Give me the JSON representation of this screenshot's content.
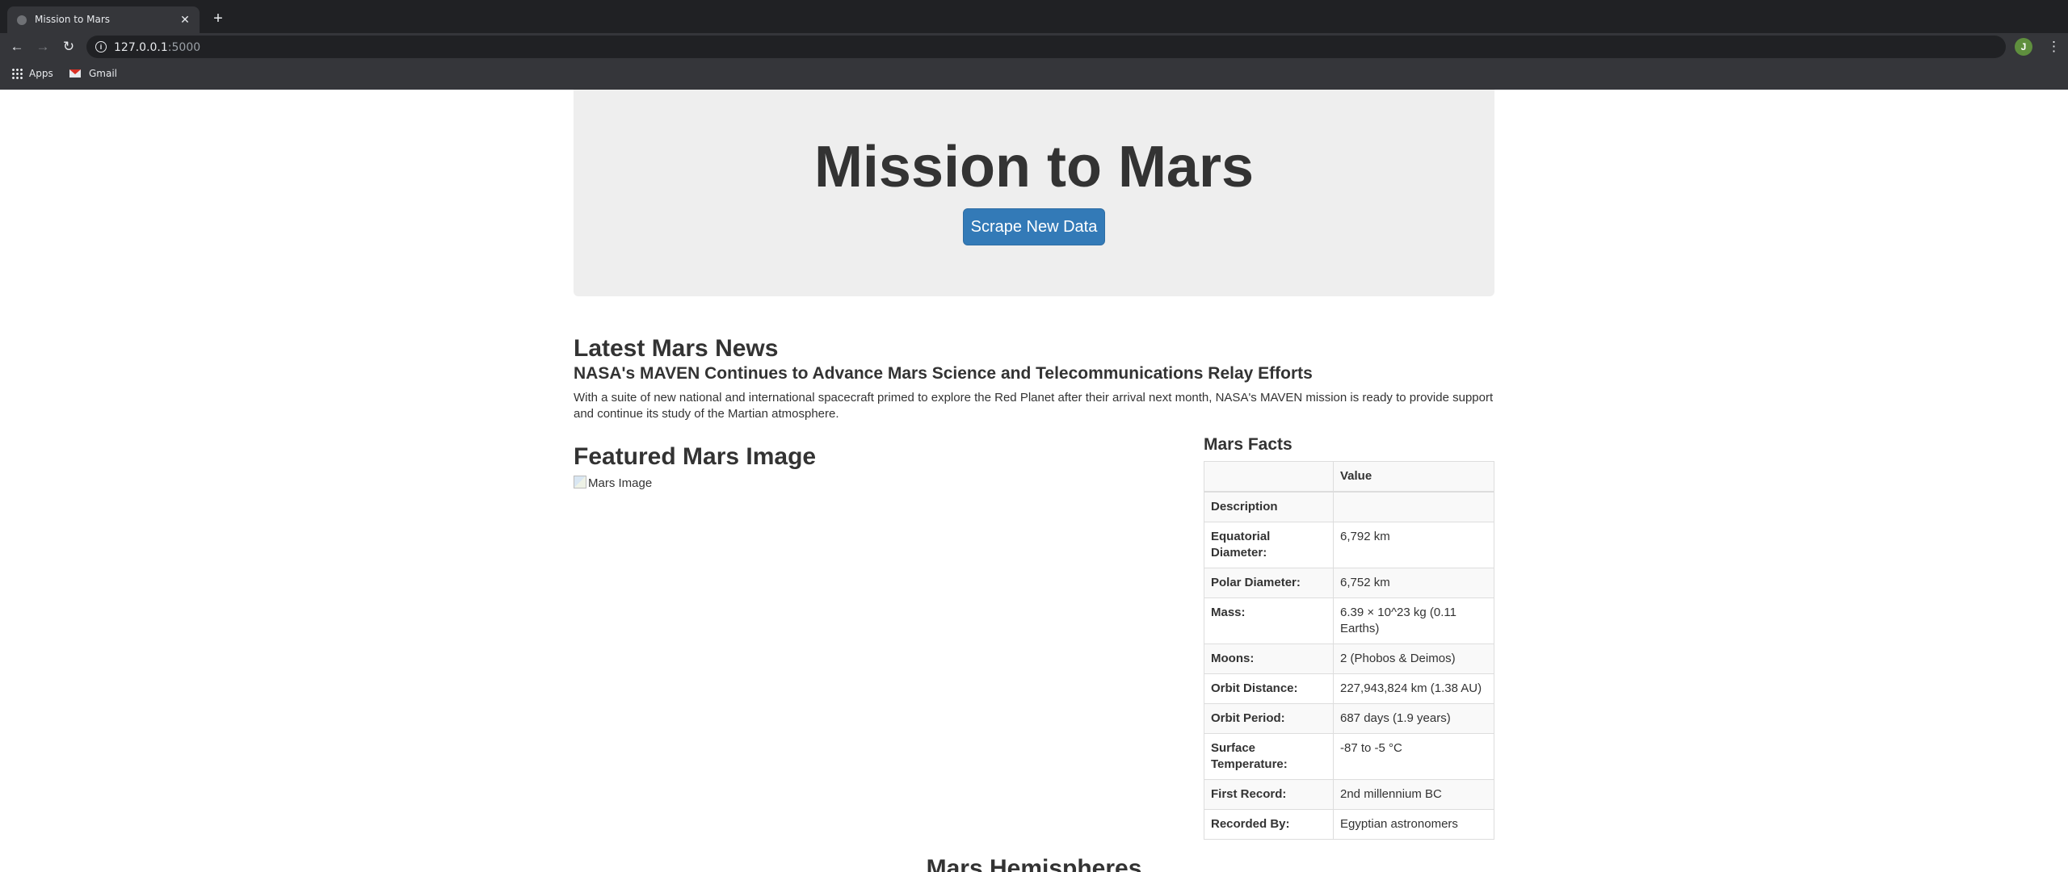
{
  "browser": {
    "tab_title": "Mission to Mars",
    "tab_close": "✕",
    "new_tab": "+",
    "url_host": "127.0.0.1",
    "url_port": ":5000",
    "avatar_letter": "J",
    "bookmarks": [
      {
        "label": "Apps",
        "icon": "apps-icon"
      },
      {
        "label": "Gmail",
        "icon": "gmail-icon"
      }
    ]
  },
  "page": {
    "title": "Mission to Mars",
    "scrape_button": "Scrape New Data",
    "news": {
      "heading": "Latest Mars News",
      "title": "NASA's MAVEN Continues to Advance Mars Science and Telecommunications Relay Efforts",
      "paragraph": "With a suite of new national and international spacecraft primed to explore the Red Planet after their arrival next month, NASA's MAVEN mission is ready to provide support and continue its study of the Martian atmosphere."
    },
    "featured_image": {
      "heading": "Featured Mars Image",
      "alt": "Mars Image"
    },
    "facts": {
      "heading": "Mars Facts",
      "header": [
        "",
        "Value"
      ],
      "rows": [
        {
          "label": "Description",
          "value": ""
        },
        {
          "label": "Equatorial Diameter:",
          "value": "6,792 km"
        },
        {
          "label": "Polar Diameter:",
          "value": "6,752 km"
        },
        {
          "label": "Mass:",
          "value": "6.39 × 10^23 kg (0.11 Earths)"
        },
        {
          "label": "Moons:",
          "value": "2 (Phobos & Deimos)"
        },
        {
          "label": "Orbit Distance:",
          "value": "227,943,824 km (1.38 AU)"
        },
        {
          "label": "Orbit Period:",
          "value": "687 days (1.9 years)"
        },
        {
          "label": "Surface Temperature:",
          "value": "-87 to -5 °C"
        },
        {
          "label": "First Record:",
          "value": "2nd millennium BC"
        },
        {
          "label": "Recorded By:",
          "value": "Egyptian astronomers"
        }
      ]
    },
    "hemispheres_heading": "Mars Hemispheres"
  }
}
